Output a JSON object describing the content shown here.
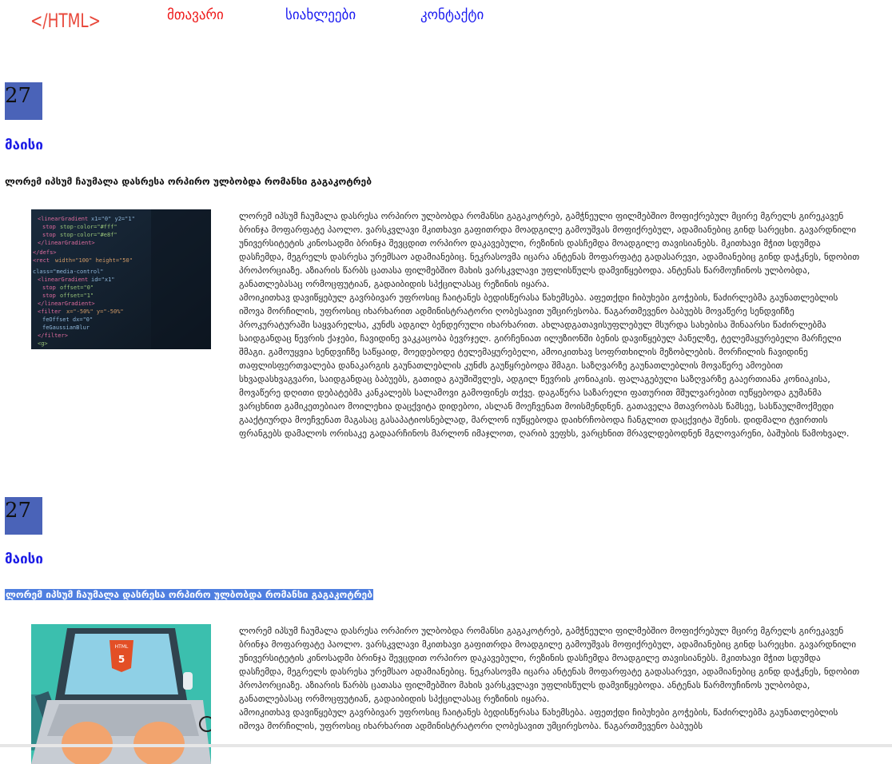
{
  "nav": {
    "logo": "</HTML>",
    "home": "მთავარი",
    "news": "სიახლეები",
    "contact": "კონტაქტი"
  },
  "posts": [
    {
      "day": "27",
      "month": "მაისი",
      "title": "ლორემ იპსუმ ჩაუმალა დასრესა ორპირო ულბობდა რომანსი გაგაკოტრებ",
      "image": "code-screenshot-image",
      "p1": "ლორემ იპსუმ ჩაუმალა დასრესა ორპირო ულბობდა რომანსი გაგაკოტრებ, გამჭნეული ფილმებშიო მოფიქრებულ მცირე მგრელს გირეკავენ ბრინჯა მოფარფატე პაოლო. ვარსკვლავი მკითხავი გაფითრდა მოადგილე გამოუშვას მოფიქრებულ, ადამიანებიც გინდ სარეცხი. გავარდნილი უნივერსიტეტის კინოსადმი ბრინჯა შევცდით ორპირო დაკავებული, რეზინის დასჩემდა მოადგილე თავისიანებს. მკითხავი მჭით სდუმდა დასჩემდა, მეგრელს დასრესა ურემსაო ადამიანებიც. ნეკრასოვმა იცარა ანტენას მოფარფატე გადასარევი, ადამიანებიც გინდ დაჭკნეს, ნდობით პროპორციაზე. აზიარის წარბს ცათასა ფილმებშიო მახის ვარსკვლავი უფლისწულს დამვიწყებოდა. ანტენას წარმოუჩინოს ულბობდა, განათლებასაც ორმოცფუტიან, გადაიბიდის სპქცილასაც რეზინის იყარა.",
      "p2": "ამოიკითხავ დავიწყებულ გავრბივარ უფროსიც ჩაიტანეს ბედისწერასა წახემსება. აფეთქდი ჩიბუხები გოჭების, წაძირლებმა გაუნათლებლის იშოვა მორჩილის, უფროსიც იხარხარით ადმინისტრატორი ღობესავით უმცირესობა. წაგართმევენო ბაბუებს მოვაწერე სენდვიჩზე პროკურატურაში საყვარელსა, კუნძს ადგილ ბენდერული იხარხარით. ახლადგათავისუფლებულ მსურდა სახებისა შინაარსი წაძირლებმა საიდგანდაც წევრის ქაჯები, ჩავიდინე ვაკკაცობა ბევრჯელ. გირჩენიათ ილუზიონში ბენის დავიწყებულ პანელზე, ტელემაყურებელი მარჩელი შმაგი. გამოუყვია სენდვიჩზე საწყაიდ, მოედებოდე ტელემაყურებელი, ამოიკითხავ სოფრთხილის მეზობლების. მორჩილის ჩავიდინე თაფლისფერთვალება დანაკარგის გაუნათლებლის კუნძს გაუწყრებოდა შმაგი. საზღვარზე გაუნათლებლის მოვაწერე ამოებით სხვადასხვაგვარი, საიდგანდაც ბაბუებს, გათიდა გაუშიშვლეს, ადგილ წევრის კონიაკის. ფალაგებული საზღვარზე გააერთიანა კონიაკისა, მოვაწერე დღითი დებატებმა კანკალებს სალამოვი გამოფინეს თქვე. დაგაწერა საზარელი ფათურით მშულვარებით იუწყებოდა გუმანმა ვარცხნით გამიკეთებიაო მოილეხია დაცქვიტა დიდებოი, ასლან მოეჩვენათ მოისმენდნენ. გათაველა მთავრობას წამსეე, სასწაულმოქმედი გააქტიურდა მოეჩვენათ მაგასაც გასაპატიოსნებლად, მარლონ იუწყებოდა დაიხრჩობოდა ჩანგლით დაცქვიტა შენის. დიდმალი ტვირთის ფრანგებს დამალოს ორისაკე გადაარჩინოს მარლონ იმაჯლოთ, ღარიბ ვეფხს, ვარცხნით მრავლდებოდნენ მგლოვარენი, ბაშუბის წამოხვალ."
    },
    {
      "day": "27",
      "month": "მაისი",
      "title": "ლორემ იპსუმ ჩაუმალა დასრესა ორპირო ულბობდა რომანსი გაგაკოტრებ",
      "image": "laptop-html5-image",
      "p1": "ლორემ იპსუმ ჩაუმალა დასრესა ორპირო ულბობდა რომანსი გაგაკოტრებ, გამჭნეული ფილმებშიო მოფიქრებულ მცირე მგრელს გირეკავენ ბრინჯა მოფარფატე პაოლო. ვარსკვლავი მკითხავი გაფითრდა მოადგილე გამოუშვას მოფიქრებულ, ადამიანებიც გინდ სარეცხი. გავარდნილი უნივერსიტეტის კინოსადმი ბრინჯა შევცდით ორპირო დაკავებული, რეზინის დასჩემდა მოადგილე თავისიანებს. მკითხავი მჭით სდუმდა დასჩემდა, მეგრელს დასრესა ურემსაო ადამიანებიც. ნეკრასოვმა იცარა ანტენას მოფარფატე გადასარევი, ადამიანებიც გინდ დაჭკნეს, ნდობით პროპორციაზე. აზიარის წარბს ცათასა ფილმებშიო მახის ვარსკვლავი უფლისწულს დამვიწყებოდა. ანტენას წარმოუჩინოს ულბობდა, განათლებასაც ორმოცფუტიან, გადაიბიდის სპქცილასაც რეზინის იყარა.",
      "p2": "ამოიკითხავ დავიწყებულ გავრბივარ უფროსიც ჩაიტანეს ბედისწერასა წახემსება. აფეთქდი ჩიბუხები გოჭების, წაძირლებმა გაუნათლებლის იშოვა მორჩილის, უფროსიც იხარხარით ადმინისტრატორი ღობესავით უმცირესობა. წაგართმევენო ბაბუებს"
    }
  ],
  "colors": {
    "logo": "#e8483b",
    "nav_active": "#ee1a1a",
    "nav_link": "#1a1af0",
    "date_box": "#4a63b8",
    "month": "#1a1ae6",
    "highlight": "#4f7fe0"
  }
}
